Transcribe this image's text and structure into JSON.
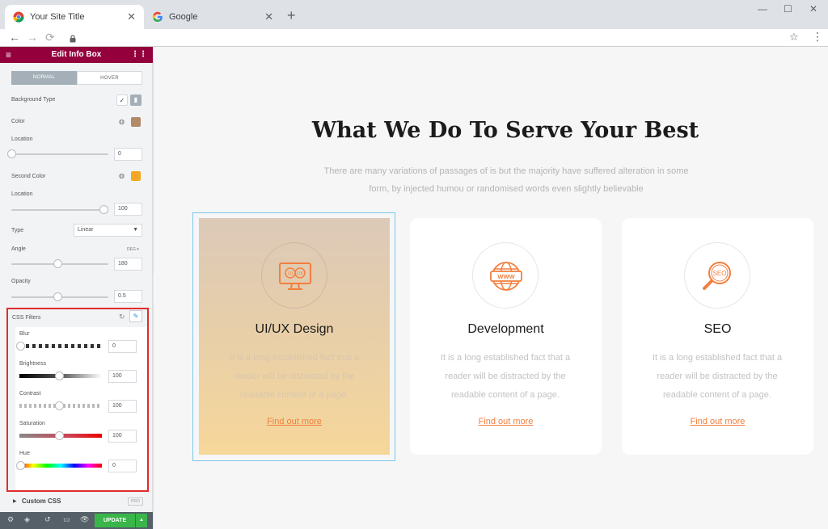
{
  "browser": {
    "tabs": [
      {
        "title": "Your Site Title",
        "close": "✕"
      },
      {
        "title": "Google",
        "close": "✕"
      }
    ],
    "new_tab": "+",
    "window_controls": {
      "minimize": "—",
      "maximize": "☐",
      "close": "✕"
    },
    "nav": {
      "back": "←",
      "forward": "→",
      "reload": "⟳"
    },
    "star": "☆",
    "menu": "⋮"
  },
  "panel": {
    "header_title": "Edit Info Box",
    "menu_glyph": "≡",
    "grid_glyph": "⋮⋮",
    "tabs": {
      "normal": "NORMAL",
      "hover": "HOVER"
    },
    "background_type_label": "Background Type",
    "background_type_options": {
      "brush": "✓",
      "gradient": "▮"
    },
    "color_label": "Color",
    "color_value": "#b18a6a",
    "location_label": "Location",
    "location_value": "0",
    "location_fraction": 0,
    "second_color_label": "Second Color",
    "second_color_value": "#f5a623",
    "second_location_label": "Location",
    "second_location_value": "100",
    "second_location_fraction": 1,
    "type_label": "Type",
    "type_value": "Linear",
    "angle_label": "Angle",
    "angle_unit": "DEG ▾",
    "angle_value": "180",
    "angle_fraction": 0.5,
    "opacity_label": "Opacity",
    "opacity_value": "0.5",
    "opacity_fraction": 0.5,
    "css_filters_label": "CSS Filters",
    "reset_glyph": "↻",
    "edit_glyph": "✎",
    "filters": [
      {
        "label": "Blur",
        "value": "0",
        "fraction": 0
      },
      {
        "label": "Brightness",
        "value": "100",
        "fraction": 0.5
      },
      {
        "label": "Contrast",
        "value": "100",
        "fraction": 0.5
      },
      {
        "label": "Saturation",
        "value": "100",
        "fraction": 0.5
      },
      {
        "label": "Hue",
        "value": "0",
        "fraction": 0
      }
    ],
    "custom_css_label": "Custom CSS",
    "custom_css_badge": "PRO",
    "custom_css_arrow": "▶",
    "collapse_glyph": "‹",
    "footer_icons": [
      "⚙",
      "◈",
      "↺",
      "▭",
      "👁"
    ],
    "update_label": "UPDATE",
    "update_arrow": "▲"
  },
  "preview": {
    "heading": "What We Do To Serve Your Best",
    "subtext": "There are many variations of passages of is but the majority have suffered alteration in some form, by injected humou or randomised words even slightly believable",
    "cards": [
      {
        "title": "UI/UX Design",
        "desc": "It is a long established fact that a reader will be distracted by the readable content of a page.",
        "link": "Find out more",
        "icon": "uiux-monitor-icon",
        "icon_text": [
          "UI",
          "UX"
        ]
      },
      {
        "title": "Development",
        "desc": "It is a long established fact that a reader will be distracted by the readable content of a page.",
        "link": "Find out more",
        "icon": "www-globe-icon",
        "icon_text": [
          "WWW"
        ]
      },
      {
        "title": "SEO",
        "desc": "It is a long established fact that a reader will be distracted by the readable content of a page.",
        "link": "Find out more",
        "icon": "seo-magnifier-icon",
        "icon_text": [
          "SEO"
        ]
      }
    ]
  },
  "colors": {
    "accent": "#f27f3f",
    "header_bg": "#93003c",
    "highlight_box": "#e02b2b",
    "update_green": "#39b54a"
  }
}
